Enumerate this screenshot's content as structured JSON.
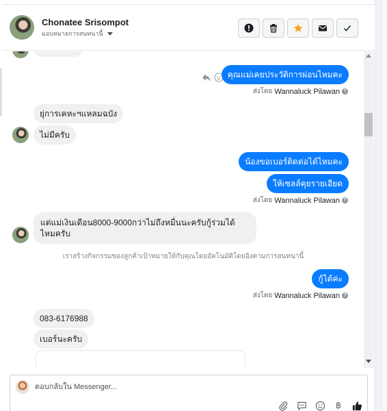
{
  "header": {
    "contact_name": "Chonatee Srisompot",
    "assign_label": "มอบหมายการสนทนานี้",
    "actions": {
      "alert": "alert-icon",
      "delete": "trash-icon",
      "star": "star-icon",
      "mail": "mail-icon",
      "done": "check-icon"
    }
  },
  "messages": {
    "out_1": "คุณแม่เคยประวัติการผ่อนไหมคะ",
    "sent_by_prefix": "ส่งโดย",
    "sender": "Wannaluck Pilawan",
    "help": "?",
    "in_1": "ยุ่การเคหะฯแหลมฉบัง",
    "in_2": "ไม่มีครับ",
    "out_2": "น้องขอเบอร์ติดต่อได้ไหมคะ",
    "out_3": "ให้เซลล์คุยรายเอียด",
    "in_3": "แต่แม่เงินเดือน8000-9000กว่าไม่ถึงหมื่นนะครับกู้ร่วมได้ไหมครับ",
    "system_note": "เราสร้างกิจกรรมของลูกค้าเป้าหมายให้กับคุณโดยอัตโนมัติโดยอิงตามการสนทนานี้",
    "out_4": "กู้ได้ค่ะ",
    "in_4": "083-6176988",
    "in_5": "เบอร์นะครับ"
  },
  "composer": {
    "placeholder": "ตอบกลับใน Messenger...",
    "tools": [
      "attach-icon",
      "saved-replies-icon",
      "emoji-icon",
      "payment-icon",
      "like-icon"
    ],
    "currency_symbol": "฿"
  },
  "colors": {
    "outgoing": "#0a7cff",
    "incoming": "#f0f0f0",
    "star": "#f5a623"
  }
}
